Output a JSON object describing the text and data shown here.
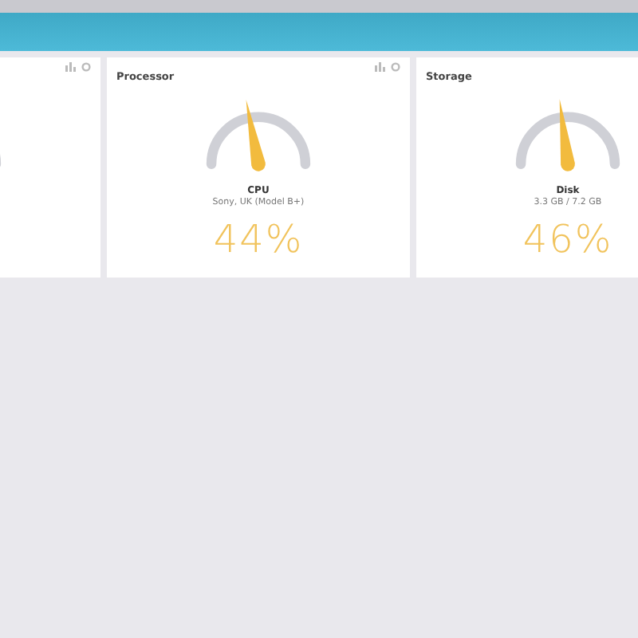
{
  "cards": [
    {
      "kind": "gauge"
    },
    {
      "kind": "gauge",
      "title": "Processor",
      "level": 0.44,
      "label": "CPU",
      "detail": "Sony, UK (Model B+)",
      "value": "44%"
    },
    {
      "kind": "gauge",
      "title": "Storage",
      "level": 0.46,
      "label": "Disk",
      "detail": "3.3 GB / 7.2 GB",
      "value": "46%"
    }
  ]
}
